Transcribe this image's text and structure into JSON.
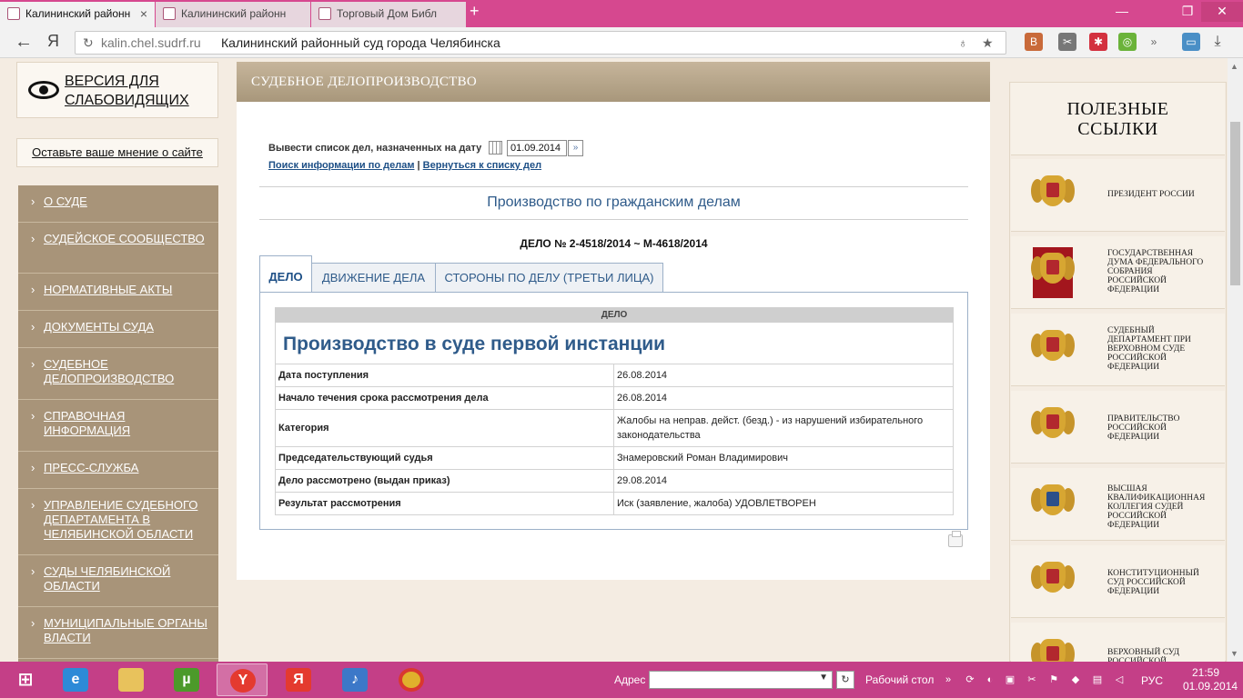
{
  "browser": {
    "tabs": [
      {
        "title": "Калининский районн",
        "active": true
      },
      {
        "title": "Калининский районн",
        "active": false
      },
      {
        "title": "Торговый Дом Библ",
        "active": false
      }
    ],
    "new_tab": "+",
    "window_controls": {
      "minimize": "—",
      "restore": "❐",
      "close": "✕"
    },
    "back": "←",
    "logo": "Я",
    "url_host": "kalin.chel.sudrf.ru",
    "url_title": "Калининский районный суд города Челябинска"
  },
  "sidebar": {
    "accessibility_label": "ВЕРСИЯ ДЛЯ СЛАБОВИДЯЩИХ",
    "feedback_link": "Оставьте ваше мнение о сайте",
    "menu_arrow": "›",
    "menu": [
      "О СУДЕ",
      "СУДЕЙСКОЕ СООБЩЕСТВО",
      "НОРМАТИВНЫЕ АКТЫ",
      "ДОКУМЕНТЫ СУДА",
      "СУДЕБНОЕ ДЕЛОПРОИЗВОДСТВО",
      "СПРАВОЧНАЯ ИНФОРМАЦИЯ",
      "ПРЕСС-СЛУЖБА",
      "УПРАВЛЕНИЕ СУДЕБНОГО ДЕПАРТАМЕНТА В ЧЕЛЯБИНСКОЙ ОБЛАСТИ",
      "СУДЫ ЧЕЛЯБИНСКОЙ ОБЛАСТИ",
      "МУНИЦИПАЛЬНЫЕ ОРГАНЫ ВЛАСТИ"
    ]
  },
  "content": {
    "header": "СУДЕБНОЕ ДЕЛОПРОИЗВОДСТВО",
    "date_label": "Вывести список дел, назначенных на дату",
    "date_value": "01.09.2014",
    "link_search": "Поиск информации по делам",
    "link_separator": "|",
    "link_back": "Вернуться к списку дел",
    "section_title": "Производство по гражданским делам",
    "case_number": "ДЕЛО № 2-4518/2014 ~ М-4618/2014",
    "tabs": [
      "ДЕЛО",
      "ДВИЖЕНИЕ ДЕЛА",
      "СТОРОНЫ ПО ДЕЛУ (ТРЕТЬИ ЛИЦА)"
    ],
    "table_header": "ДЕЛО",
    "table_title": "Производство в суде первой инстанции",
    "rows": [
      {
        "label": "Дата поступления",
        "value": "26.08.2014"
      },
      {
        "label": "Начало течения срока рассмотрения дела",
        "value": "26.08.2014"
      },
      {
        "label": "Категория",
        "value": "Жалобы на неправ. дейст. (безд.) - из нарушений избирательного законодательства"
      },
      {
        "label": "Председательствующий судья",
        "value": "Знамеровский Роман Владимирович"
      },
      {
        "label": "Дело рассмотрено (выдан приказ)",
        "value": "29.08.2014"
      },
      {
        "label": "Результат рассмотрения",
        "value": "Иск (заявление, жалоба) УДОВЛЕТВОРЕН"
      }
    ]
  },
  "right_links": {
    "title": "ПОЛЕЗНЫЕ ССЫЛКИ",
    "items": [
      "ПРЕЗИДЕНТ РОССИИ",
      "ГОСУДАРСТВЕННАЯ ДУМА ФЕДЕРАЛЬНОГО СОБРАНИЯ РОССИЙСКОЙ ФЕДЕРАЦИИ",
      "СУДЕБНЫЙ ДЕПАРТАМЕНТ ПРИ ВЕРХОВНОМ СУДЕ РОССИЙСКОЙ ФЕДЕРАЦИИ",
      "ПРАВИТЕЛЬСТВО РОССИЙСКОЙ ФЕДЕРАЦИИ",
      "ВЫСШАЯ КВАЛИФИКАЦИОННАЯ КОЛЛЕГИЯ СУДЕЙ РОССИЙСКОЙ ФЕДЕРАЦИИ",
      "КОНСТИТУЦИОННЫЙ СУД РОССИЙСКОЙ ФЕДЕРАЦИИ",
      "ВЕРХОВНЫЙ СУД РОССИЙСКОЙ"
    ]
  },
  "taskbar": {
    "address_label": "Адрес",
    "desktop_label": "Рабочий стол",
    "language": "РУС",
    "time": "21:59",
    "date": "01.09.2014"
  }
}
